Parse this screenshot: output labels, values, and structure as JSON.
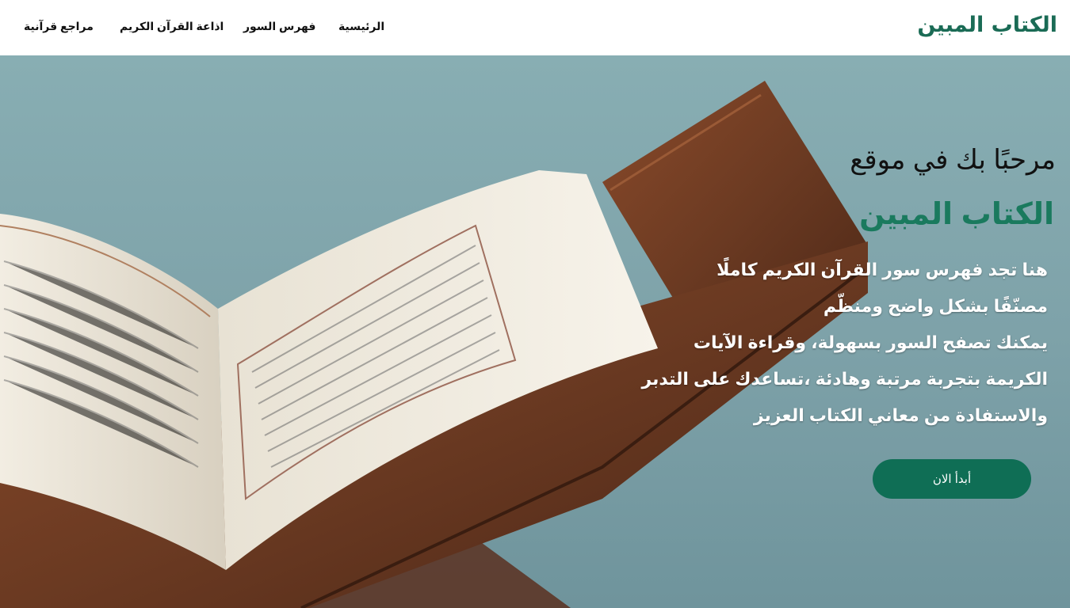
{
  "navbar": {
    "brand": "الكتاب المبين",
    "links": [
      "الرئيسية",
      "فهرس السور",
      "اذاعة القرآن الكريم",
      "مراجع قرآنية"
    ]
  },
  "hero": {
    "welcome": "مرحبًا بك في موقع",
    "site_name": "الكتاب المبين",
    "description_lines": [
      "هنا تجد فهرس سور القرآن الكريم كاملًا",
      "مصنّفًا بشكل واضح ومنظّم",
      "يمكنك تصفح السور بسهولة، وقراءة الآيات",
      "الكريمة بتجربة مرتبة وهادئة ،تساعدك على التدبر",
      "والاستفادة من معاني الكتاب العزيز"
    ],
    "button_label": "أبدأ الان"
  },
  "colors": {
    "brand_green": "#1a6b55",
    "button_green": "#0f6e55",
    "hero_sky": "#7fa3aa",
    "wood": "#6b3a22"
  }
}
